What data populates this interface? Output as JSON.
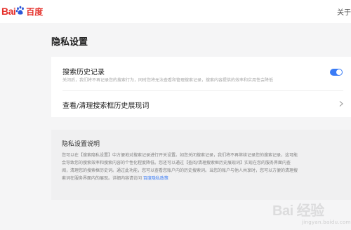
{
  "header": {
    "logo_text_bai": "Bai",
    "logo_text_du": "du",
    "logo_text_cn": "百度",
    "about_label": "关于百度"
  },
  "page": {
    "title": "隐私设置"
  },
  "settings": {
    "search_history": {
      "title": "搜索历史记录",
      "description": "关闭后，我们将不再记录您的搜索行为，同时您将无法查看和管理搜索记录，搜索内容提供的效率和实用性会降低",
      "enabled": true
    },
    "history_link": {
      "title": "查看/清理搜索框历史展现词"
    }
  },
  "info": {
    "title": "隐私设置说明",
    "body_lines": [
      "您可以在【搜索隐私设置】中方便地对搜索记录进行开关设置。如您关闭搜索记录，我们将不再继续记录您的搜索记录，这可能",
      "会导致您的搜索效率和搜索内容的个性化程度降低。您还可以通过【查阅/清理搜索框历史展现词】实现在您的服务界面内查",
      "阅，清理您的搜索框历史词。通过此功能，您可以查看您账户内的历史搜索词。当您的账户与他人共享时，您可以方便的清理搜",
      "索词在服务界面内的展现。详细内容请访问 "
    ],
    "link_text": "百度隐私政策"
  },
  "watermark": {
    "main": "Bai 经验",
    "sub": "jingyan.baidu.com"
  },
  "colors": {
    "accent": "#3a7cf6",
    "brand_red": "#e52f2a",
    "brand_blue": "#2b56d8"
  }
}
